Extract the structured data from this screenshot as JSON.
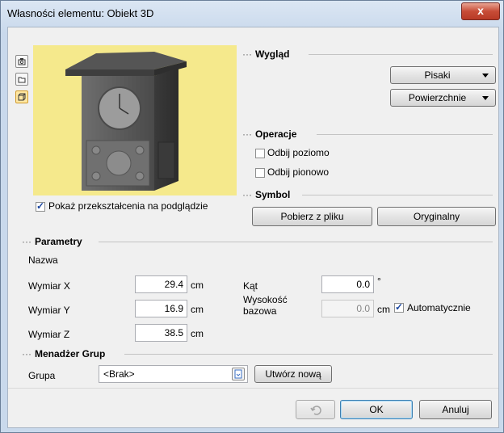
{
  "window": {
    "title": "Własności elementu: Obiekt 3D",
    "close_label": "x"
  },
  "appearance": {
    "header": "Wygląd",
    "pens_label": "Pisaki",
    "surfaces_label": "Powierzchnie"
  },
  "operations": {
    "header": "Operacje",
    "flip_horizontal": {
      "label": "Odbij poziomo",
      "checked": false
    },
    "flip_vertical": {
      "label": "Odbij pionowo",
      "checked": false
    }
  },
  "symbol": {
    "header": "Symbol",
    "load_from_file": "Pobierz z pliku",
    "original": "Oryginalny"
  },
  "preview": {
    "show_transformations": {
      "label": "Pokaż przekształcenia na podglądzie",
      "checked": true
    },
    "view_icons": [
      "camera-icon",
      "folder-icon",
      "cube-icon"
    ]
  },
  "parameters": {
    "header": "Parametry",
    "name_label": "Nazwa",
    "dim_x": {
      "label": "Wymiar X",
      "value": "29.4",
      "unit": "cm"
    },
    "dim_y": {
      "label": "Wymiar Y",
      "value": "16.9",
      "unit": "cm"
    },
    "dim_z": {
      "label": "Wymiar Z",
      "value": "38.5",
      "unit": "cm"
    },
    "angle": {
      "label": "Kąt",
      "value": "0.0",
      "unit": "°"
    },
    "base_height": {
      "label_line1": "Wysokość",
      "label_line2": "bazowa",
      "value": "0.0",
      "unit": "cm"
    },
    "automatic": {
      "label": "Automatycznie",
      "checked": true
    }
  },
  "groups": {
    "header": "Menadżer Grup",
    "group_label": "Grupa",
    "group_value": "<Brak>",
    "create_new": "Utwórz nową"
  },
  "footer": {
    "ok": "OK",
    "cancel": "Anuluj"
  }
}
